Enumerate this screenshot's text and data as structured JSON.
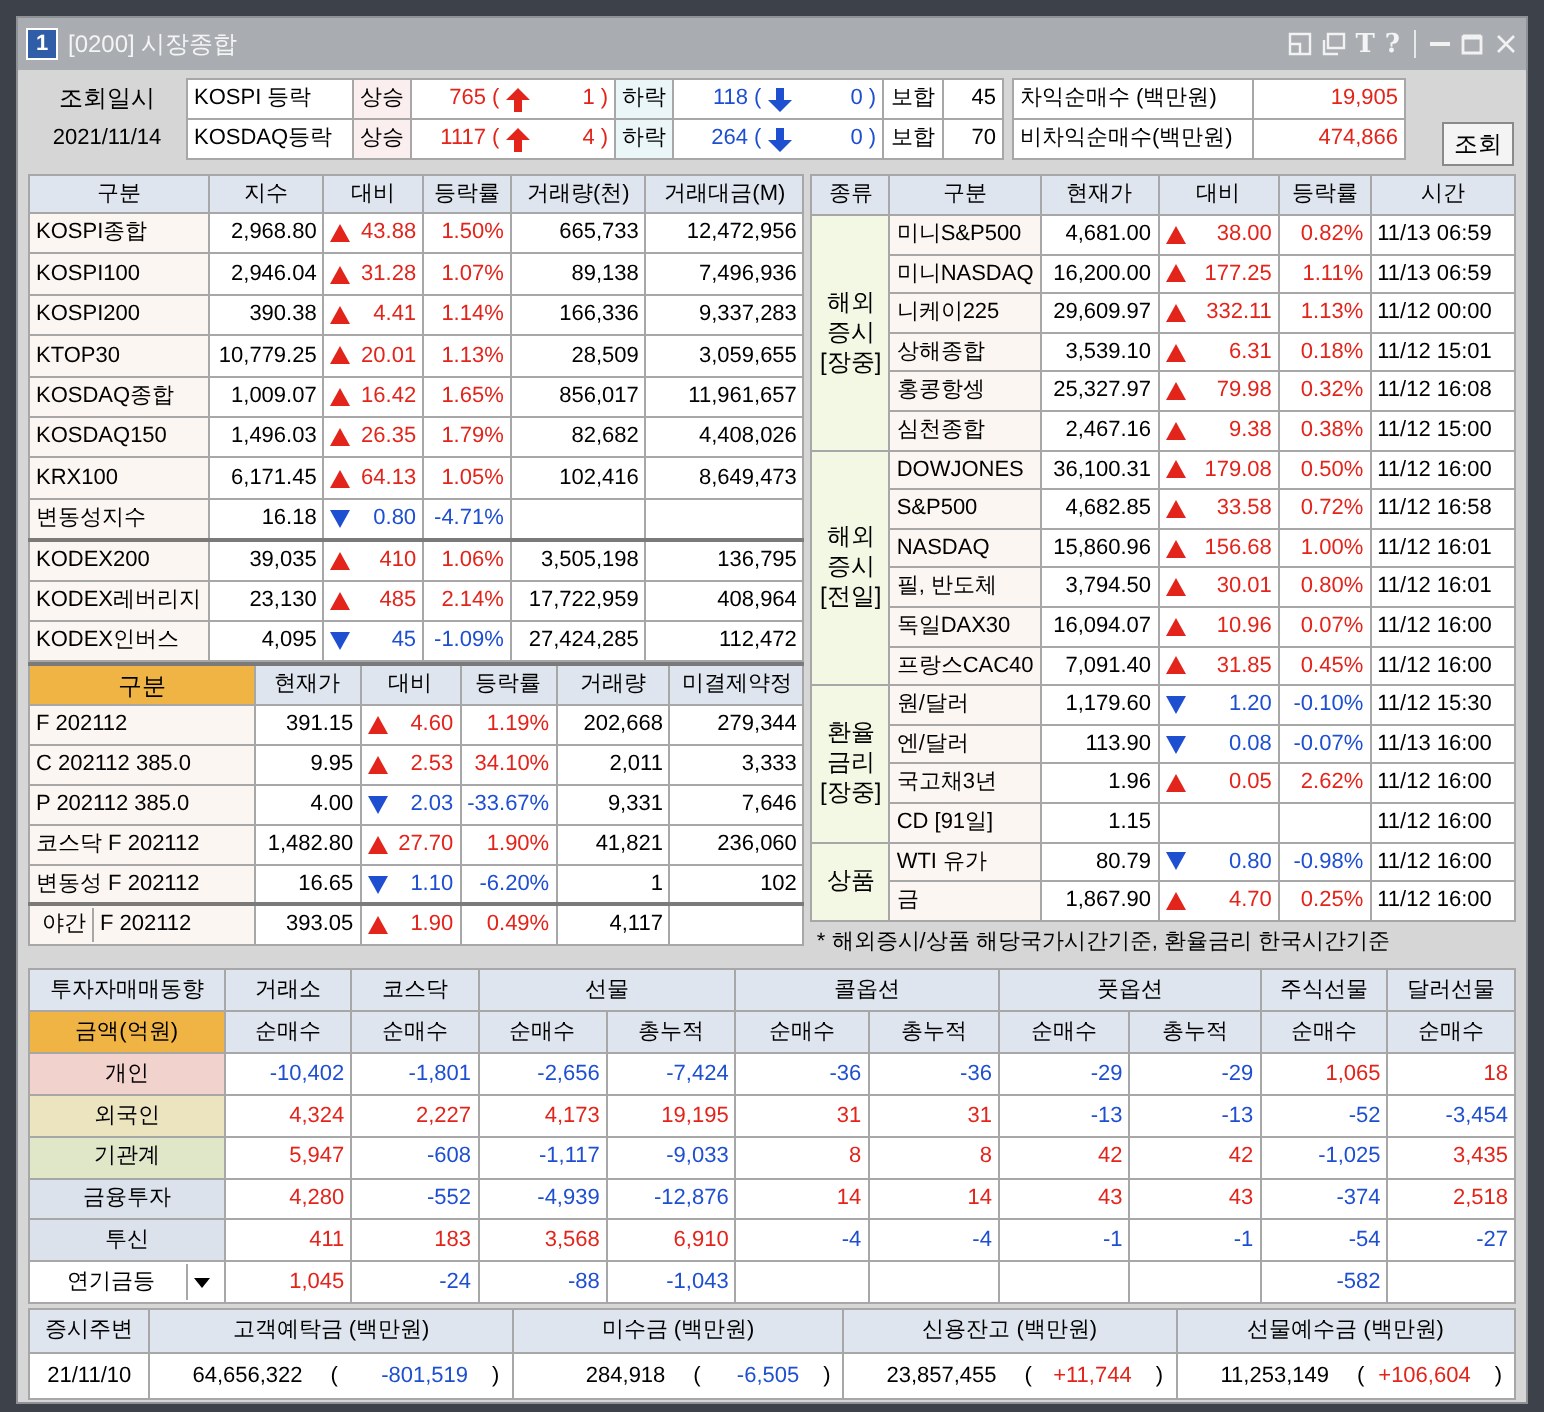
{
  "window": {
    "badge": "1",
    "title": "[0200] 시장종합",
    "tools": [
      "T",
      "?"
    ]
  },
  "breadth": {
    "label": "조회일시",
    "date": "2021/11/14",
    "rows": [
      {
        "market": "KOSPI 등락",
        "up_label": "상승",
        "up": [
          "765",
          "(",
          "1",
          ")"
        ],
        "down_label": "하락",
        "down": [
          "118",
          "(",
          "0",
          ")"
        ],
        "flat_label": "보합",
        "flat": "45"
      },
      {
        "market": "KOSDAQ등락",
        "up_label": "상승",
        "up": [
          "1117",
          "(",
          "4",
          ")"
        ],
        "down_label": "하락",
        "down": [
          "264",
          "(",
          "0",
          ")"
        ],
        "flat_label": "보합",
        "flat": "70"
      }
    ]
  },
  "arbitrage": [
    {
      "label": "차익순매수 (백만원)",
      "value": "19,905"
    },
    {
      "label": "비차익순매수(백만원)",
      "value": "474,866"
    }
  ],
  "query_button": "조회",
  "index_table": {
    "columns": [
      "구분",
      "지수",
      "대비",
      "등락률",
      "거래량(천)",
      "거래대금(M)"
    ],
    "groups": [
      [
        {
          "name": "KOSPI종합",
          "value": "2,968.80",
          "rising": true,
          "change": "43.88",
          "rate": "1.50%",
          "volume": "665,733",
          "amount": "12,472,956"
        },
        {
          "name": "KOSPI100",
          "value": "2,946.04",
          "rising": true,
          "change": "31.28",
          "rate": "1.07%",
          "volume": "89,138",
          "amount": "7,496,936"
        },
        {
          "name": "KOSPI200",
          "value": "390.38",
          "rising": true,
          "change": "4.41",
          "rate": "1.14%",
          "volume": "166,336",
          "amount": "9,337,283"
        },
        {
          "name": "KTOP30",
          "value": "10,779.25",
          "rising": true,
          "change": "20.01",
          "rate": "1.13%",
          "volume": "28,509",
          "amount": "3,059,655"
        },
        {
          "name": "KOSDAQ종합",
          "value": "1,009.07",
          "rising": true,
          "change": "16.42",
          "rate": "1.65%",
          "volume": "856,017",
          "amount": "11,961,657"
        },
        {
          "name": "KOSDAQ150",
          "value": "1,496.03",
          "rising": true,
          "change": "26.35",
          "rate": "1.79%",
          "volume": "82,682",
          "amount": "4,408,026"
        },
        {
          "name": "KRX100",
          "value": "6,171.45",
          "rising": true,
          "change": "64.13",
          "rate": "1.05%",
          "volume": "102,416",
          "amount": "8,649,473"
        },
        {
          "name": "변동성지수",
          "value": "16.18",
          "rising": false,
          "change": "0.80",
          "rate": "-4.71%"
        }
      ],
      [
        {
          "name": "KODEX200",
          "value": "39,035",
          "rising": true,
          "change": "410",
          "rate": "1.06%",
          "volume": "3,505,198",
          "amount": "136,795"
        },
        {
          "name": "KODEX레버리지",
          "value": "23,130",
          "rising": true,
          "change": "485",
          "rate": "2.14%",
          "volume": "17,722,959",
          "amount": "408,964"
        },
        {
          "name": "KODEX인버스",
          "value": "4,095",
          "rising": false,
          "change": "45",
          "rate": "-1.09%",
          "volume": "27,424,285",
          "amount": "112,472"
        }
      ]
    ]
  },
  "futures_table": {
    "columns": [
      "구분",
      "현재가",
      "대비",
      "등락률",
      "거래량",
      "미결제약정"
    ],
    "rows": [
      {
        "name": "F 202112",
        "value": "391.15",
        "rising": true,
        "change": "4.60",
        "rate": "1.19%",
        "volume": "202,668",
        "open_interest": "279,344"
      },
      {
        "name": "C 202112 385.0",
        "value": "9.95",
        "rising": true,
        "change": "2.53",
        "rate": "34.10%",
        "volume": "2,011",
        "open_interest": "3,333"
      },
      {
        "name": "P 202112 385.0",
        "value": "4.00",
        "rising": false,
        "change": "2.03",
        "rate": "-33.67%",
        "volume": "9,331",
        "open_interest": "7,646"
      },
      {
        "name": "코스닥 F 202112",
        "value": "1,482.80",
        "rising": true,
        "change": "27.70",
        "rate": "1.90%",
        "volume": "41,821",
        "open_interest": "236,060"
      },
      {
        "name": "변동성 F 202112",
        "value": "16.65",
        "rising": false,
        "change": "1.10",
        "rate": "-6.20%",
        "volume": "1",
        "open_interest": "102"
      },
      {
        "tag": "야간",
        "name": "F 202112",
        "value": "393.05",
        "rising": true,
        "change": "1.90",
        "rate": "0.49%",
        "volume": "4,117"
      }
    ]
  },
  "world_table": {
    "columns": [
      "종류",
      "구분",
      "현재가",
      "대비",
      "등락률",
      "시간"
    ],
    "groups": [
      {
        "label": [
          "해외",
          "증시",
          "[장중]"
        ],
        "rows": [
          {
            "name": "미니S&P500",
            "value": "4,681.00",
            "rising": true,
            "change": "38.00",
            "rate": "0.82%",
            "time": "11/13 06:59"
          },
          {
            "name": "미니NASDAQ",
            "value": "16,200.00",
            "rising": true,
            "change": "177.25",
            "rate": "1.11%",
            "time": "11/13 06:59"
          },
          {
            "name": "니케이225",
            "value": "29,609.97",
            "rising": true,
            "change": "332.11",
            "rate": "1.13%",
            "time": "11/12 00:00"
          },
          {
            "name": "상해종합",
            "value": "3,539.10",
            "rising": true,
            "change": "6.31",
            "rate": "0.18%",
            "time": "11/12 15:01"
          },
          {
            "name": "홍콩항셍",
            "value": "25,327.97",
            "rising": true,
            "change": "79.98",
            "rate": "0.32%",
            "time": "11/12 16:08"
          },
          {
            "name": "심천종합",
            "value": "2,467.16",
            "rising": true,
            "change": "9.38",
            "rate": "0.38%",
            "time": "11/12 15:00"
          }
        ]
      },
      {
        "label": [
          "해외",
          "증시",
          "[전일]"
        ],
        "rows": [
          {
            "name": "DOWJONES",
            "value": "36,100.31",
            "rising": true,
            "change": "179.08",
            "rate": "0.50%",
            "time": "11/12 16:00"
          },
          {
            "name": "S&P500",
            "value": "4,682.85",
            "rising": true,
            "change": "33.58",
            "rate": "0.72%",
            "time": "11/12 16:58"
          },
          {
            "name": "NASDAQ",
            "value": "15,860.96",
            "rising": true,
            "change": "156.68",
            "rate": "1.00%",
            "time": "11/12 16:01"
          },
          {
            "name": "필, 반도체",
            "value": "3,794.50",
            "rising": true,
            "change": "30.01",
            "rate": "0.80%",
            "time": "11/12 16:01"
          },
          {
            "name": "독일DAX30",
            "value": "16,094.07",
            "rising": true,
            "change": "10.96",
            "rate": "0.07%",
            "time": "11/12 16:00"
          },
          {
            "name": "프랑스CAC40",
            "value": "7,091.40",
            "rising": true,
            "change": "31.85",
            "rate": "0.45%",
            "time": "11/12 16:00"
          }
        ]
      },
      {
        "label": [
          "환율",
          "금리",
          "[장중]"
        ],
        "rows": [
          {
            "name": "원/달러",
            "value": "1,179.60",
            "rising": false,
            "change": "1.20",
            "rate": "-0.10%",
            "time": "11/12 15:30"
          },
          {
            "name": "엔/달러",
            "value": "113.90",
            "rising": false,
            "change": "0.08",
            "rate": "-0.07%",
            "time": "11/13 16:00"
          },
          {
            "name": "국고채3년",
            "value": "1.96",
            "rising": true,
            "change": "0.05",
            "rate": "2.62%",
            "time": "11/12 16:00"
          },
          {
            "name": "CD [91일]",
            "value": "1.15",
            "time": "11/12 16:00"
          }
        ]
      },
      {
        "label": [
          "상품"
        ],
        "rows": [
          {
            "name": "WTI 유가",
            "value": "80.79",
            "rising": false,
            "change": "0.80",
            "rate": "-0.98%",
            "time": "11/12 16:00"
          },
          {
            "name": "금",
            "value": "1,867.90",
            "rising": true,
            "change": "4.70",
            "rate": "0.25%",
            "time": "11/12 16:00"
          }
        ]
      }
    ],
    "note": "* 해외증시/상품 해당국가시간기준, 환율금리 한국시간기준"
  },
  "investor_table": {
    "title": "투자자매매동향",
    "unit": "금액(억원)",
    "groups": [
      {
        "label": "거래소",
        "sub": [
          "순매수"
        ]
      },
      {
        "label": "코스닥",
        "sub": [
          "순매수"
        ]
      },
      {
        "label": "선물",
        "sub": [
          "순매수",
          "총누적"
        ]
      },
      {
        "label": "콜옵션",
        "sub": [
          "순매수",
          "총누적"
        ]
      },
      {
        "label": "풋옵션",
        "sub": [
          "순매수",
          "총누적"
        ]
      },
      {
        "label": "주식선물",
        "sub": [
          "순매수"
        ]
      },
      {
        "label": "달러선물",
        "sub": [
          "순매수"
        ]
      }
    ],
    "rows": [
      {
        "name": "개인",
        "color": "#f2d2cc",
        "exchange": "-10,402",
        "kosdaq": "-1,801",
        "futures_net": "-2,656",
        "futures_total": "-7,424",
        "call_net": "-36",
        "call_total": "-36",
        "put_net": "-29",
        "put_total": "-29",
        "stock_futures_net": "1,065",
        "dollar_futures_net": "18"
      },
      {
        "name": "외국인",
        "color": "#ece3bf",
        "exchange": "4,324",
        "kosdaq": "2,227",
        "futures_net": "4,173",
        "futures_total": "19,195",
        "call_net": "31",
        "call_total": "31",
        "put_net": "-13",
        "put_total": "-13",
        "stock_futures_net": "-52",
        "dollar_futures_net": "-3,454"
      },
      {
        "name": "기관계",
        "color": "#dfe7c8",
        "exchange": "5,947",
        "kosdaq": "-608",
        "futures_net": "-1,117",
        "futures_total": "-9,033",
        "call_net": "8",
        "call_total": "8",
        "put_net": "42",
        "put_total": "42",
        "stock_futures_net": "-1,025",
        "dollar_futures_net": "3,435"
      },
      {
        "name": "금융투자",
        "color": "#dbe2ec",
        "exchange": "4,280",
        "kosdaq": "-552",
        "futures_net": "-4,939",
        "futures_total": "-12,876",
        "call_net": "14",
        "call_total": "14",
        "put_net": "43",
        "put_total": "43",
        "stock_futures_net": "-374",
        "dollar_futures_net": "2,518"
      },
      {
        "name": "투신",
        "color": "#dbe2ec",
        "exchange": "411",
        "kosdaq": "183",
        "futures_net": "3,568",
        "futures_total": "6,910",
        "call_net": "-4",
        "call_total": "-4",
        "put_net": "-1",
        "put_total": "-1",
        "stock_futures_net": "-54",
        "dollar_futures_net": "-27"
      },
      {
        "name": "연기금등",
        "kind": "dropdown",
        "color": "#ffffff",
        "exchange": "1,045",
        "kosdaq": "-24",
        "futures_net": "-88",
        "futures_total": "-1,043",
        "stock_futures_net": "-582"
      }
    ]
  },
  "market_funds": {
    "label": "증시주변",
    "date": "21/11/10",
    "items": [
      {
        "label": "고객예탁금 (백만원)",
        "value": "64,656,322",
        "open": "(",
        "change": "-801,519",
        "close": ")"
      },
      {
        "label": "미수금 (백만원)",
        "value": "284,918",
        "open": "(",
        "change": "-6,505",
        "close": ")"
      },
      {
        "label": "신용잔고 (백만원)",
        "value": "23,857,455",
        "open": "(",
        "change": "+11,744",
        "close": ")"
      },
      {
        "label": "선물예수금 (백만원)",
        "value": "11,253,149",
        "open": "(",
        "change": "+106,604",
        "close": ")"
      }
    ]
  }
}
